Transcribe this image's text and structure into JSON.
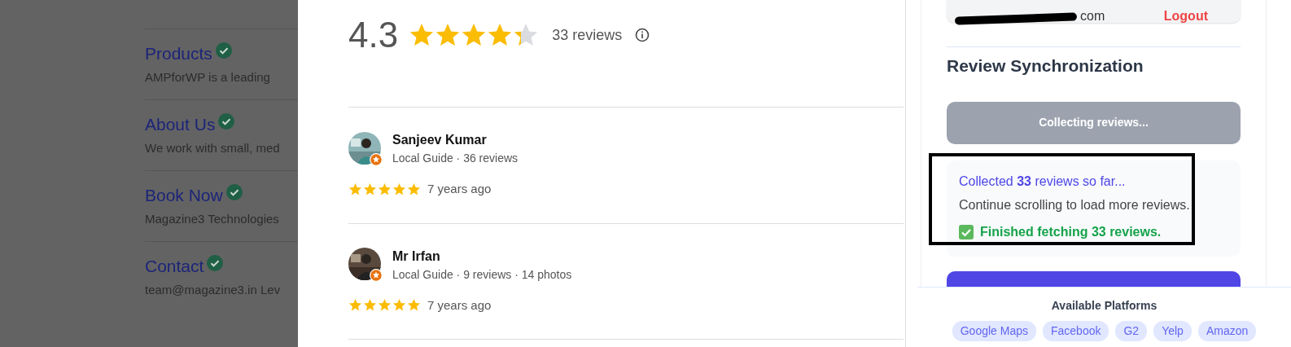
{
  "background_page": {
    "items": [
      {
        "title": "Products",
        "description": "AMPforWP is a leading",
        "verified": true
      },
      {
        "title": "About Us",
        "description": "We work with small, med",
        "verified": true
      },
      {
        "title": "Book Now",
        "description": "Magazine3 Technologies",
        "verified": true
      },
      {
        "title": "Contact",
        "description": "team@magazine3.in Lev",
        "verified": true
      }
    ]
  },
  "reviews_panel": {
    "rating": "4.3",
    "stars": 4.3,
    "review_count": "33 reviews",
    "reviews": [
      {
        "name": "Sanjeev Kumar",
        "meta": "Local Guide · 36 reviews",
        "stars": 5,
        "time": "7 years ago",
        "local_guide": true
      },
      {
        "name": "Mr Irfan",
        "meta": "Local Guide · 9 reviews · 14 photos",
        "stars": 5,
        "time": "7 years ago",
        "local_guide": true
      }
    ]
  },
  "sync_panel": {
    "account": {
      "email": "com",
      "logout": "Logout"
    },
    "heading": "Review Synchronization",
    "collect_button": {
      "label": "Collecting reviews...",
      "disabled": true
    },
    "status": {
      "progress": "Collected **33** reviews so far...",
      "hint": "Continue scrolling to load more reviews.",
      "done": "Finished fetching 33 reviews.",
      "finished": true
    },
    "platforms_title": "Available Platforms",
    "platforms": [
      "Google Maps",
      "Facebook",
      "G2",
      "Yelp",
      "Amazon"
    ]
  }
}
